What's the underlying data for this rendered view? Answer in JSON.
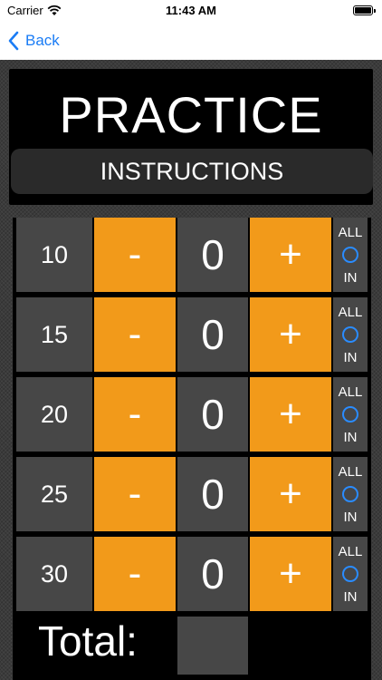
{
  "status_bar": {
    "carrier": "Carrier",
    "time": "11:43 AM"
  },
  "navbar": {
    "back_label": "Back"
  },
  "header": {
    "title": "PRACTICE",
    "instructions_label": "INSTRUCTIONS"
  },
  "rows": [
    {
      "score": "10",
      "minus": "-",
      "count": "0",
      "plus": "+",
      "all": "ALL",
      "in": "IN"
    },
    {
      "score": "15",
      "minus": "-",
      "count": "0",
      "plus": "+",
      "all": "ALL",
      "in": "IN"
    },
    {
      "score": "20",
      "minus": "-",
      "count": "0",
      "plus": "+",
      "all": "ALL",
      "in": "IN"
    },
    {
      "score": "25",
      "minus": "-",
      "count": "0",
      "plus": "+",
      "all": "ALL",
      "in": "IN"
    },
    {
      "score": "30",
      "minus": "-",
      "count": "0",
      "plus": "+",
      "all": "ALL",
      "in": "IN"
    }
  ],
  "footer": {
    "total_label": "Total:"
  },
  "icons": {
    "back": "chevron-left-icon",
    "wifi": "wifi-icon",
    "battery": "battery-icon",
    "radio": "radio-circle-icon"
  },
  "colors": {
    "accent": "#f29a1a",
    "link": "#1a7cf5",
    "cell": "#474747",
    "panel": "#000000"
  }
}
